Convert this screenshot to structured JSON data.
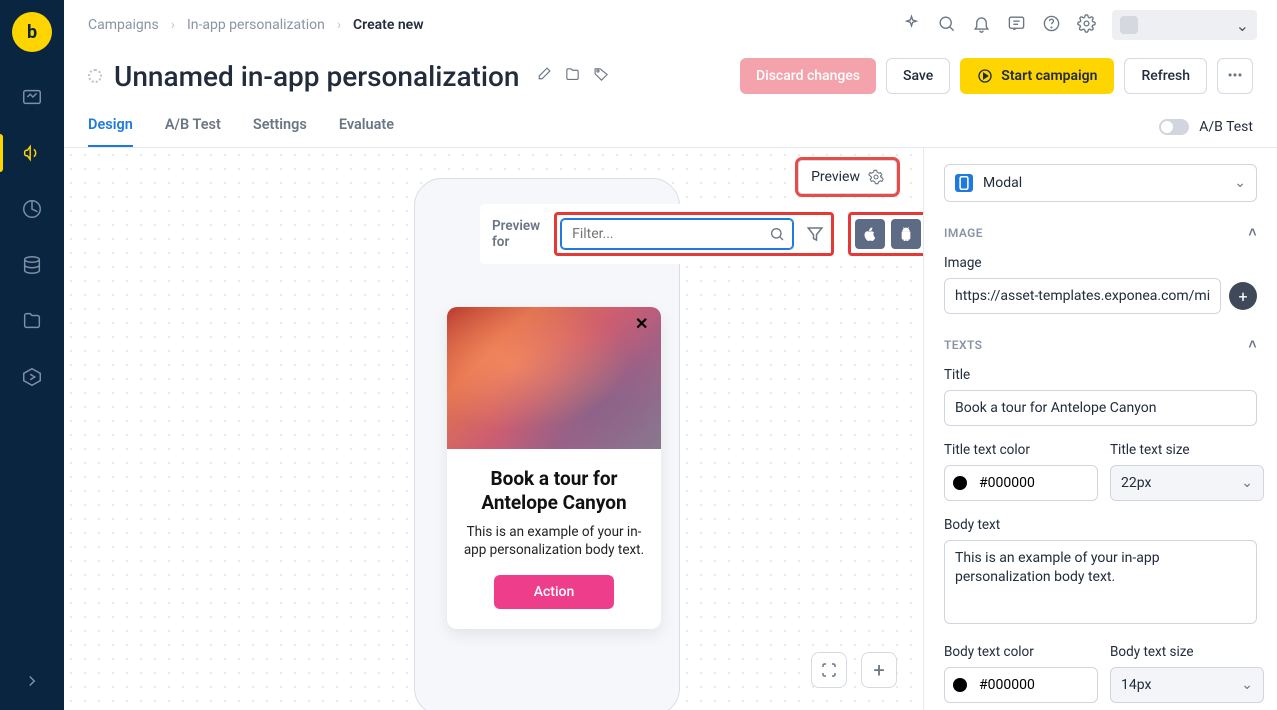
{
  "breadcrumbs": {
    "level1": "Campaigns",
    "level2": "In-app personalization",
    "level3": "Create new"
  },
  "title": "Unnamed in-app personalization",
  "buttons": {
    "discard": "Discard changes",
    "save": "Save",
    "start": "Start campaign",
    "refresh": "Refresh"
  },
  "tabs": {
    "design": "Design",
    "ab": "A/B Test",
    "settings": "Settings",
    "evaluate": "Evaluate",
    "abtoggle_label": "A/B Test"
  },
  "preview_button": "Preview",
  "filter": {
    "label": "Preview for",
    "placeholder": "Filter..."
  },
  "modal_preview": {
    "title": "Book a tour for Antelope Canyon",
    "body": "This is an example of your in-app personalization body text.",
    "action": "Action"
  },
  "panel": {
    "template_select": "Modal",
    "section_image": "IMAGE",
    "image_label": "Image",
    "image_value": "https://asset-templates.exponea.com/misc",
    "section_texts": "TEXTS",
    "title_label": "Title",
    "title_value": "Book a tour for Antelope Canyon",
    "title_color_label": "Title text color",
    "title_color_value": "#000000",
    "title_size_label": "Title text size",
    "title_size_value": "22px",
    "body_label": "Body text",
    "body_value": "This is an example of your in-app personalization body text.",
    "body_color_label": "Body text color",
    "body_color_value": "#000000",
    "body_size_label": "Body text size",
    "body_size_value": "14px"
  }
}
